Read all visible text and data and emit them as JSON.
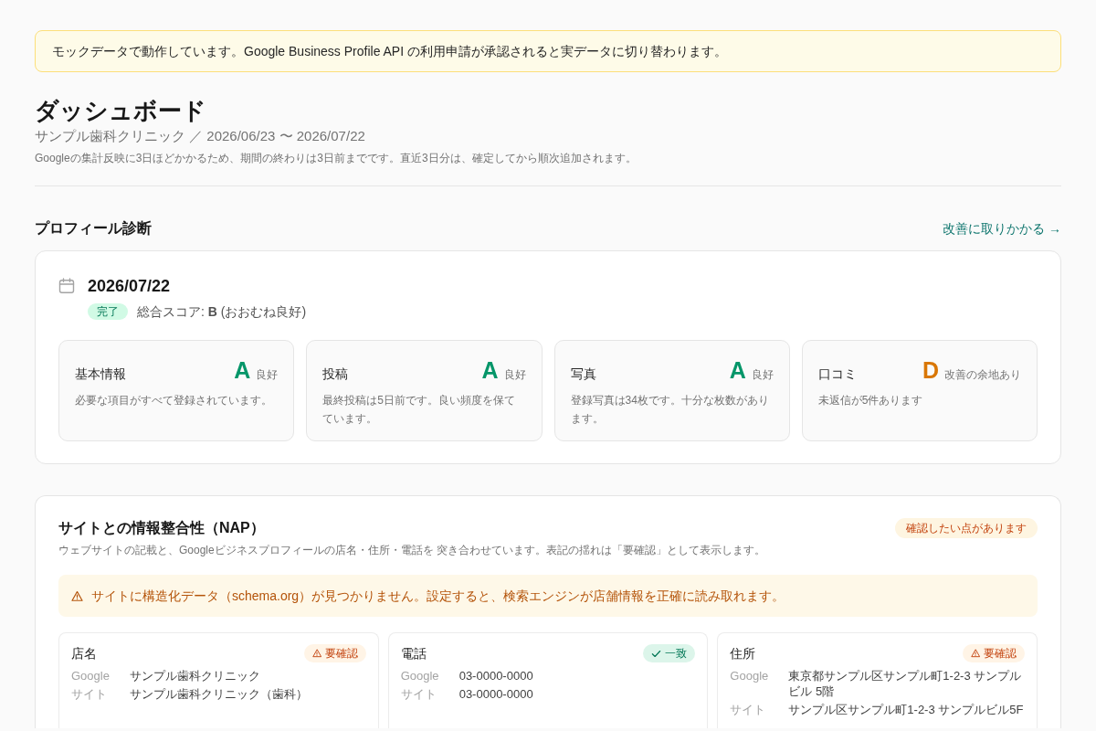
{
  "notice": {
    "text": "モックデータで動作しています。Google Business Profile API の利用申請が承認されると実データに切り替わります。"
  },
  "header": {
    "title": "ダッシュボード",
    "subtitle": "サンプル歯科クリニック ／ 2026/06/23 〜 2026/07/22",
    "note": "Googleの集計反映に3日ほどかかるため、期間の終わりは3日前までです。直近3日分は、確定してから順次追加されます。"
  },
  "profile_diagnosis": {
    "title": "プロフィール診断",
    "action_link": "改善に取りかかる →",
    "date": "2026/07/22",
    "status_badge": "完了",
    "overall_score": "総合スコア: **B** (おおむね良好)",
    "categories": [
      {
        "name": "基本情報",
        "grade": "A",
        "rating": "良好",
        "color": "#059669",
        "description": "必要な項目がすべて登録されています。"
      },
      {
        "name": "投稿",
        "grade": "A",
        "rating": "良好",
        "color": "#059669",
        "description": "最終投稿は5日前です。良い頻度を保てています。"
      },
      {
        "name": "写真",
        "grade": "A",
        "rating": "良好",
        "color": "#059669",
        "description": "登録写真は34枚です。十分な枚数があります。"
      },
      {
        "name": "口コミ",
        "grade": "D",
        "rating": "改善の余地あり",
        "color": "#d97706",
        "description": "未返信が5件あります"
      }
    ]
  },
  "nap": {
    "title": "サイトとの情報整合性（NAP）",
    "status_badge": "確認したい点があります",
    "description": "ウェブサイトの記載と、Googleビジネスプロフィールの店名・住所・電話を 突き合わせています。表記の揺れは「要確認」として表示します。",
    "warning": "サイトに構造化データ（schema.org）が見つかりません。設定すると、検索エンジンが店舗情報を正確に読み取れます。",
    "items": [
      {
        "field": "店名",
        "kind": "warning",
        "badge": "要確認",
        "rows": [
          {
            "label": "Google",
            "value": "サンプル歯科クリニック"
          },
          {
            "label": "サイト",
            "value": "サンプル歯科クリニック（歯科）"
          }
        ]
      },
      {
        "field": "電話",
        "kind": "match",
        "badge": "一致",
        "rows": [
          {
            "label": "Google",
            "value": "03-0000-0000"
          },
          {
            "label": "サイト",
            "value": "03-0000-0000"
          }
        ]
      },
      {
        "field": "住所",
        "kind": "warning",
        "badge": "要確認",
        "rows": [
          {
            "label": "Google",
            "value": "東京都サンプル区サンプル町1-2-3 サンプルビル 5階"
          },
          {
            "label": "サイト",
            "value": "サンプル区サンプル町1-2-3 サンプルビル5F"
          }
        ]
      }
    ]
  }
}
